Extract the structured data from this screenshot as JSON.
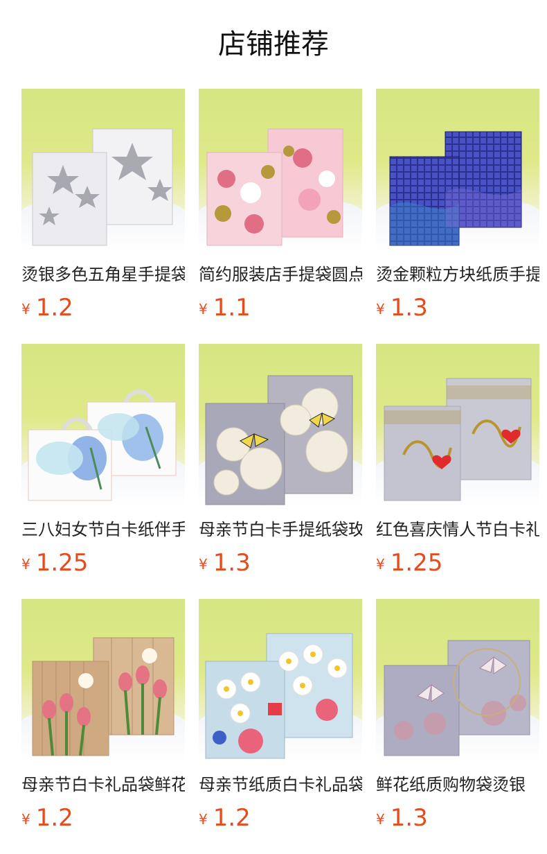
{
  "header": {
    "title": "店铺推荐"
  },
  "currency_symbol": "¥",
  "products": [
    {
      "name": "烫银多色五角星手提袋",
      "price": "1.2",
      "thumb_icon": "silver-star-bag-icon"
    },
    {
      "name": "简约服装店手提袋圆点",
      "price": "1.1",
      "thumb_icon": "pink-dot-bag-icon"
    },
    {
      "name": "烫金颗粒方块纸质手提袋",
      "price": "1.3",
      "thumb_icon": "blue-sequin-bag-icon"
    },
    {
      "name": "三八妇女节白卡纸伴手礼",
      "price": "1.25",
      "thumb_icon": "blue-flower-bag-icon"
    },
    {
      "name": "母亲节白卡手提纸袋玫瑰",
      "price": "1.3",
      "thumb_icon": "white-rose-bag-icon"
    },
    {
      "name": "红色喜庆情人节白卡礼品",
      "price": "1.25",
      "thumb_icon": "love-bag-icon"
    },
    {
      "name": "母亲节白卡礼品袋鲜花",
      "price": "1.2",
      "thumb_icon": "tulip-bag-icon"
    },
    {
      "name": "母亲节纸质白卡礼品袋",
      "price": "1.2",
      "thumb_icon": "daisy-bag-icon"
    },
    {
      "name": "鲜花纸质购物袋烫银",
      "price": "1.3",
      "thumb_icon": "butterfly-bag-icon"
    }
  ]
}
